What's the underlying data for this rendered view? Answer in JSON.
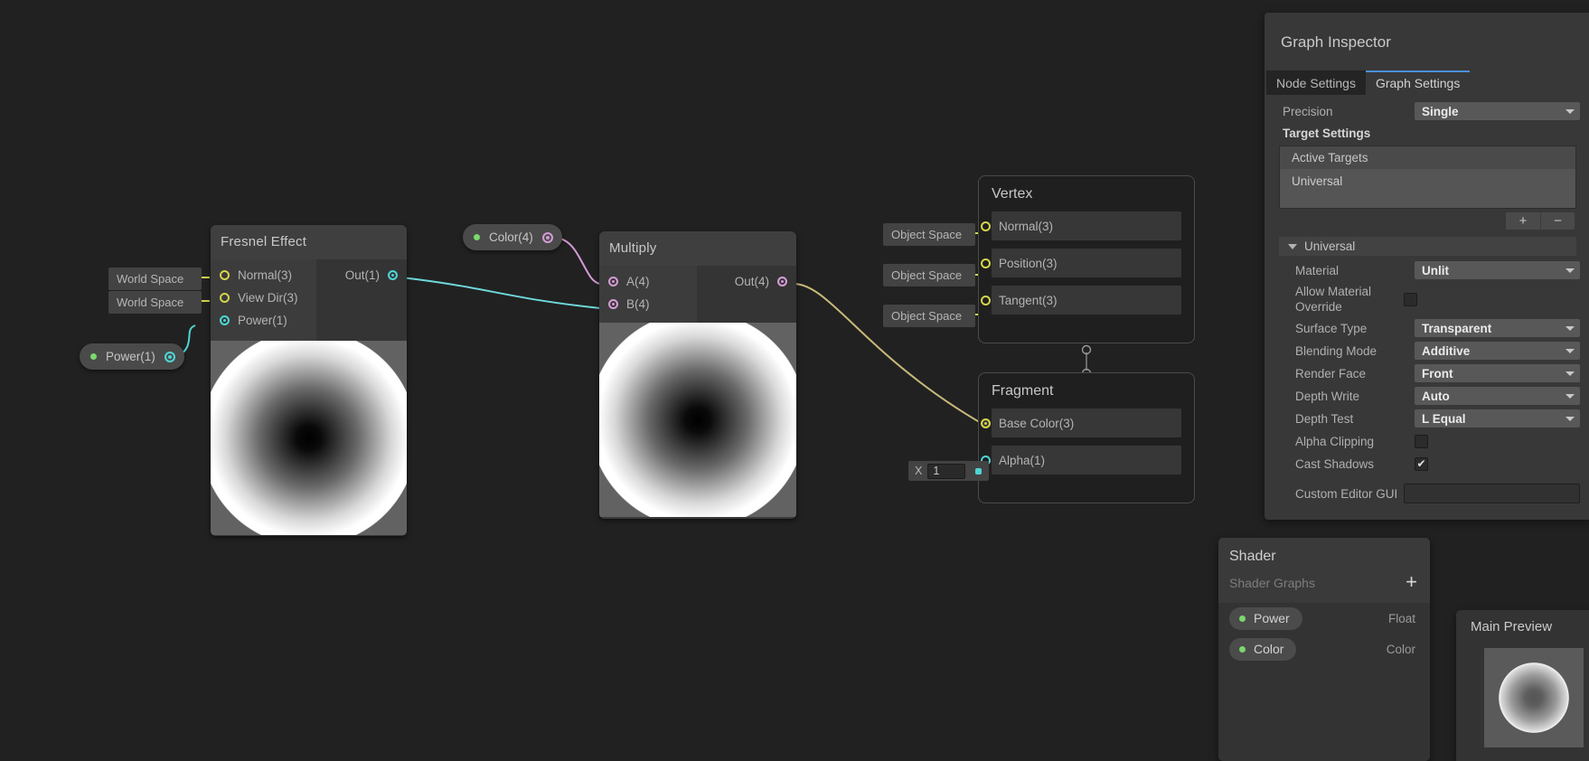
{
  "graph": {
    "nodes": [
      {
        "id": "fresnel",
        "title": "Fresnel Effect",
        "inputs": [
          {
            "label": "Normal(3)",
            "dropdown": "World Space"
          },
          {
            "label": "View Dir(3)",
            "dropdown": "World Space"
          },
          {
            "label": "Power(1)",
            "dropdown": null
          }
        ],
        "outputs": [
          {
            "label": "Out(1)"
          }
        ]
      },
      {
        "id": "multiply",
        "title": "Multiply",
        "inputs": [
          {
            "label": "A(4)"
          },
          {
            "label": "B(4)"
          }
        ],
        "outputs": [
          {
            "label": "Out(4)"
          }
        ]
      }
    ],
    "tokens": [
      {
        "id": "power-property",
        "label": "Power(1)"
      },
      {
        "id": "color-property",
        "label": "Color(4)"
      }
    ],
    "masters": [
      {
        "id": "vertex",
        "title": "Vertex",
        "rows": [
          {
            "label": "Normal(3)",
            "dropdown": "Object Space"
          },
          {
            "label": "Position(3)",
            "dropdown": "Object Space"
          },
          {
            "label": "Tangent(3)",
            "dropdown": "Object Space"
          }
        ]
      },
      {
        "id": "fragment",
        "title": "Fragment",
        "rows": [
          {
            "label": "Base Color(3)",
            "dropdown": null
          },
          {
            "label": "Alpha(1)",
            "dropdown": null
          }
        ]
      }
    ],
    "alpha_field": {
      "axis_label": "X",
      "value": "1"
    }
  },
  "inspector": {
    "title": "Graph Inspector",
    "tabs": [
      {
        "label": "Node Settings",
        "active": false
      },
      {
        "label": "Graph Settings",
        "active": true
      }
    ],
    "precision": {
      "label": "Precision",
      "value": "Single"
    },
    "target_settings_label": "Target Settings",
    "active_targets": {
      "header": "Active Targets",
      "items": [
        "Universal"
      ]
    },
    "add_button": "+",
    "remove_button": "−",
    "universal_foldout": "Universal",
    "settings": [
      {
        "label": "Material",
        "type": "dropdown",
        "value": "Unlit"
      },
      {
        "label": "Allow Material Override",
        "type": "checkbox",
        "value": false
      },
      {
        "label": "Surface Type",
        "type": "dropdown",
        "value": "Transparent"
      },
      {
        "label": "Blending Mode",
        "type": "dropdown",
        "value": "Additive"
      },
      {
        "label": "Render Face",
        "type": "dropdown",
        "value": "Front"
      },
      {
        "label": "Depth Write",
        "type": "dropdown",
        "value": "Auto"
      },
      {
        "label": "Depth Test",
        "type": "dropdown",
        "value": "L Equal"
      },
      {
        "label": "Alpha Clipping",
        "type": "checkbox",
        "value": false
      },
      {
        "label": "Cast Shadows",
        "type": "checkbox",
        "value": true
      },
      {
        "label": "Custom Editor GUI",
        "type": "textbox",
        "value": ""
      }
    ],
    "check_glyph": "✔"
  },
  "blackboard": {
    "title": "Shader",
    "subtitle": "Shader Graphs",
    "add_label": "+",
    "properties": [
      {
        "name": "Power",
        "type": "Float"
      },
      {
        "name": "Color",
        "type": "Color"
      }
    ]
  },
  "main_preview": {
    "title": "Main Preview"
  },
  "colors": {
    "background": "#212121",
    "node_body": "#343434",
    "accent_tab": "#4a90d9",
    "wire_vector": "#d4d44a",
    "wire_float": "#4fd4d4",
    "wire_color": "#d49ad4",
    "property_dot": "#7ad96b"
  }
}
